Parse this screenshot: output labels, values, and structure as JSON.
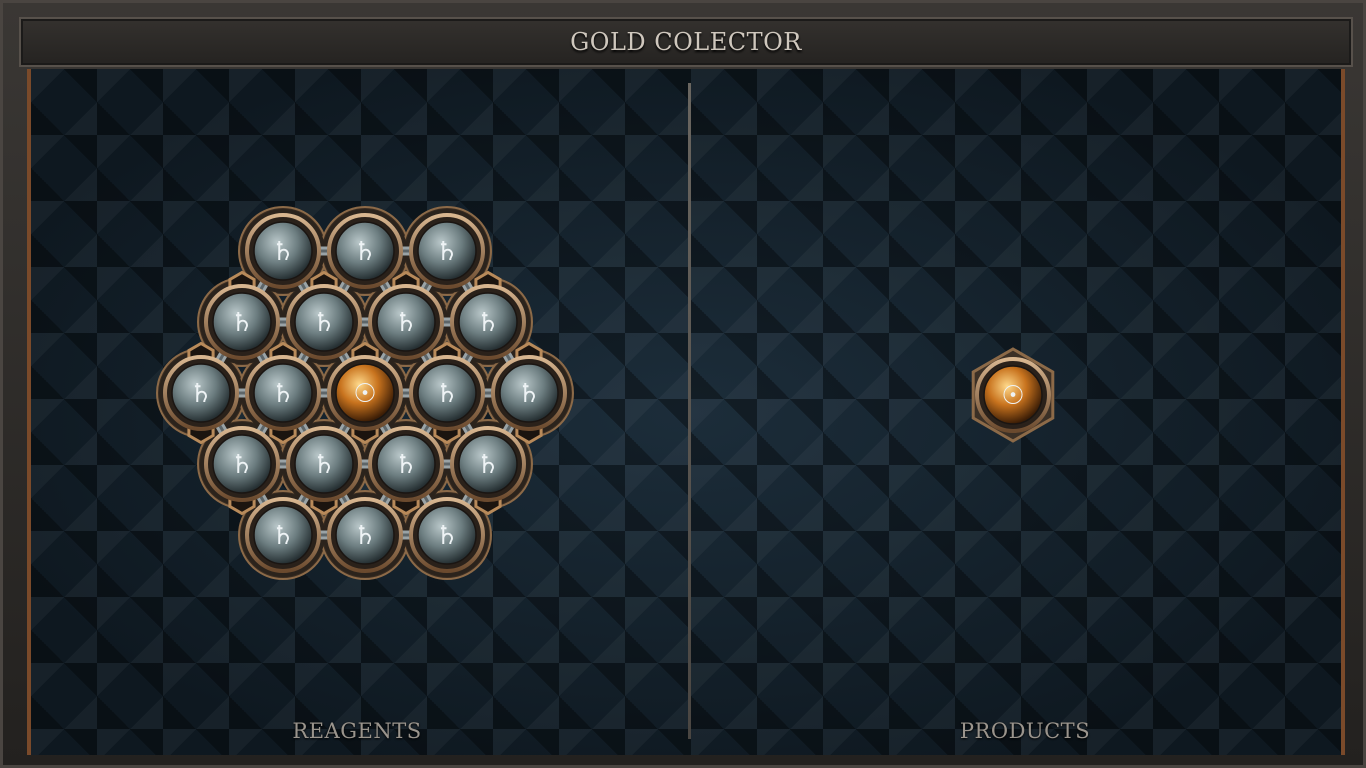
{
  "title": "GOLD COLECTOR",
  "panels": {
    "reagents_label": "REAGENTS",
    "products_label": "PRODUCTS"
  },
  "symbols": {
    "lead": "♄",
    "gold": "☉"
  },
  "reagent_molecule": {
    "atoms": [
      {
        "row": 0,
        "col": 0,
        "element": "lead"
      },
      {
        "row": 0,
        "col": 1,
        "element": "lead"
      },
      {
        "row": 0,
        "col": 2,
        "element": "lead"
      },
      {
        "row": 1,
        "col": 0,
        "element": "lead"
      },
      {
        "row": 1,
        "col": 1,
        "element": "lead"
      },
      {
        "row": 1,
        "col": 2,
        "element": "lead"
      },
      {
        "row": 1,
        "col": 3,
        "element": "lead"
      },
      {
        "row": 2,
        "col": 0,
        "element": "lead"
      },
      {
        "row": 2,
        "col": 1,
        "element": "lead"
      },
      {
        "row": 2,
        "col": 2,
        "element": "gold"
      },
      {
        "row": 2,
        "col": 3,
        "element": "lead"
      },
      {
        "row": 2,
        "col": 4,
        "element": "lead"
      },
      {
        "row": 3,
        "col": 0,
        "element": "lead"
      },
      {
        "row": 3,
        "col": 1,
        "element": "lead"
      },
      {
        "row": 3,
        "col": 2,
        "element": "lead"
      },
      {
        "row": 3,
        "col": 3,
        "element": "lead"
      },
      {
        "row": 4,
        "col": 0,
        "element": "lead"
      },
      {
        "row": 4,
        "col": 1,
        "element": "lead"
      },
      {
        "row": 4,
        "col": 2,
        "element": "lead"
      }
    ]
  },
  "product_molecule": {
    "atoms": [
      {
        "element": "gold"
      }
    ]
  },
  "colors": {
    "lead": "#6c7d80",
    "gold": "#c8731e",
    "accent": "#7a4a2a"
  }
}
